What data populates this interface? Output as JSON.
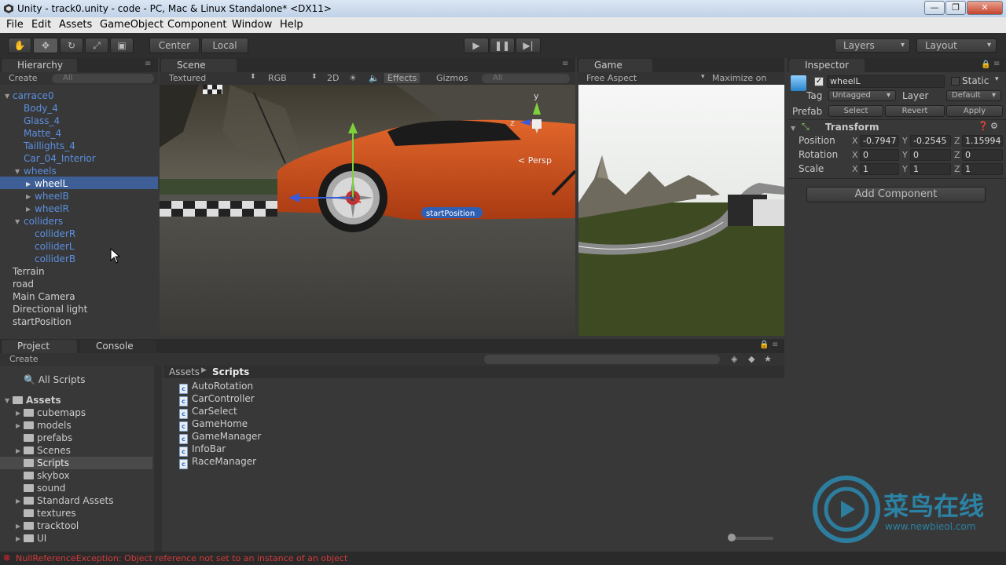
{
  "window": {
    "title": "Unity - track0.unity - code - PC, Mac & Linux Standalone* <DX11>",
    "min": "—",
    "max": "❐",
    "close": "✕"
  },
  "menu": [
    "File",
    "Edit",
    "Assets",
    "GameObject",
    "Component",
    "Window",
    "Help"
  ],
  "toolbar": {
    "pivot_center": "Center",
    "pivot_local": "Local",
    "layers": "Layers",
    "layout": "Layout"
  },
  "hierarchy": {
    "tab": "Hierarchy",
    "create": "Create",
    "search_placeholder": "All",
    "items": [
      {
        "label": "carrace0"
      },
      {
        "label": "Body_4"
      },
      {
        "label": "Glass_4"
      },
      {
        "label": "Matte_4"
      },
      {
        "label": "Taillights_4"
      },
      {
        "label": "Car_04_Interior"
      },
      {
        "label": "wheels"
      },
      {
        "label": "wheelL"
      },
      {
        "label": "wheelB"
      },
      {
        "label": "wheelR"
      },
      {
        "label": "colliders"
      },
      {
        "label": "colliderR"
      },
      {
        "label": "colliderL"
      },
      {
        "label": "colliderB"
      },
      {
        "label": "Terrain"
      },
      {
        "label": "road"
      },
      {
        "label": "Main Camera"
      },
      {
        "label": "Directional light"
      },
      {
        "label": "startPosition"
      }
    ]
  },
  "scene": {
    "tab": "Scene",
    "shading": "Textured",
    "render": "RGB",
    "mode2d": "2D",
    "effects": "Effects",
    "gizmos": "Gizmos",
    "search_placeholder": "All",
    "persp_label": "< Persp",
    "gizmo_y": "y",
    "gizmo_z": "z",
    "object_label": "startPosition"
  },
  "game": {
    "tab": "Game",
    "aspect": "Free Aspect",
    "maximize": "Maximize on Play"
  },
  "inspector": {
    "tab": "Inspector",
    "object_name": "wheelL",
    "static_label": "Static",
    "tag_label": "Tag",
    "tag_value": "Untagged",
    "layer_label": "Layer",
    "layer_value": "Default",
    "prefab_label": "Prefab",
    "prefab_select": "Select",
    "prefab_revert": "Revert",
    "prefab_apply": "Apply",
    "transform_title": "Transform",
    "position_label": "Position",
    "rotation_label": "Rotation",
    "scale_label": "Scale",
    "position": {
      "x": "-0.7947",
      "y": "-0.2545",
      "z": "1.15994"
    },
    "rotation": {
      "x": "0",
      "y": "0",
      "z": "0"
    },
    "scale": {
      "x": "1",
      "y": "1",
      "z": "1"
    },
    "add_component": "Add Component"
  },
  "project": {
    "tab": "Project",
    "console_tab": "Console",
    "create": "Create",
    "all_scripts": "All Scripts",
    "assets_root": "Assets",
    "folders": [
      "cubemaps",
      "models",
      "prefabs",
      "Scenes",
      "Scripts",
      "skybox",
      "sound",
      "Standard Assets",
      "textures",
      "tracktool",
      "UI"
    ],
    "breadcrumb_root": "Assets",
    "breadcrumb_current": "Scripts",
    "scripts": [
      "AutoRotation",
      "CarController",
      "CarSelect",
      "GameHome",
      "GameManager",
      "InfoBar",
      "RaceManager"
    ]
  },
  "watermark": {
    "text": "菜鸟在线",
    "url": "www.newbieol.com"
  },
  "status": {
    "message": "NullReferenceException: Object reference not set to an instance of an object"
  }
}
